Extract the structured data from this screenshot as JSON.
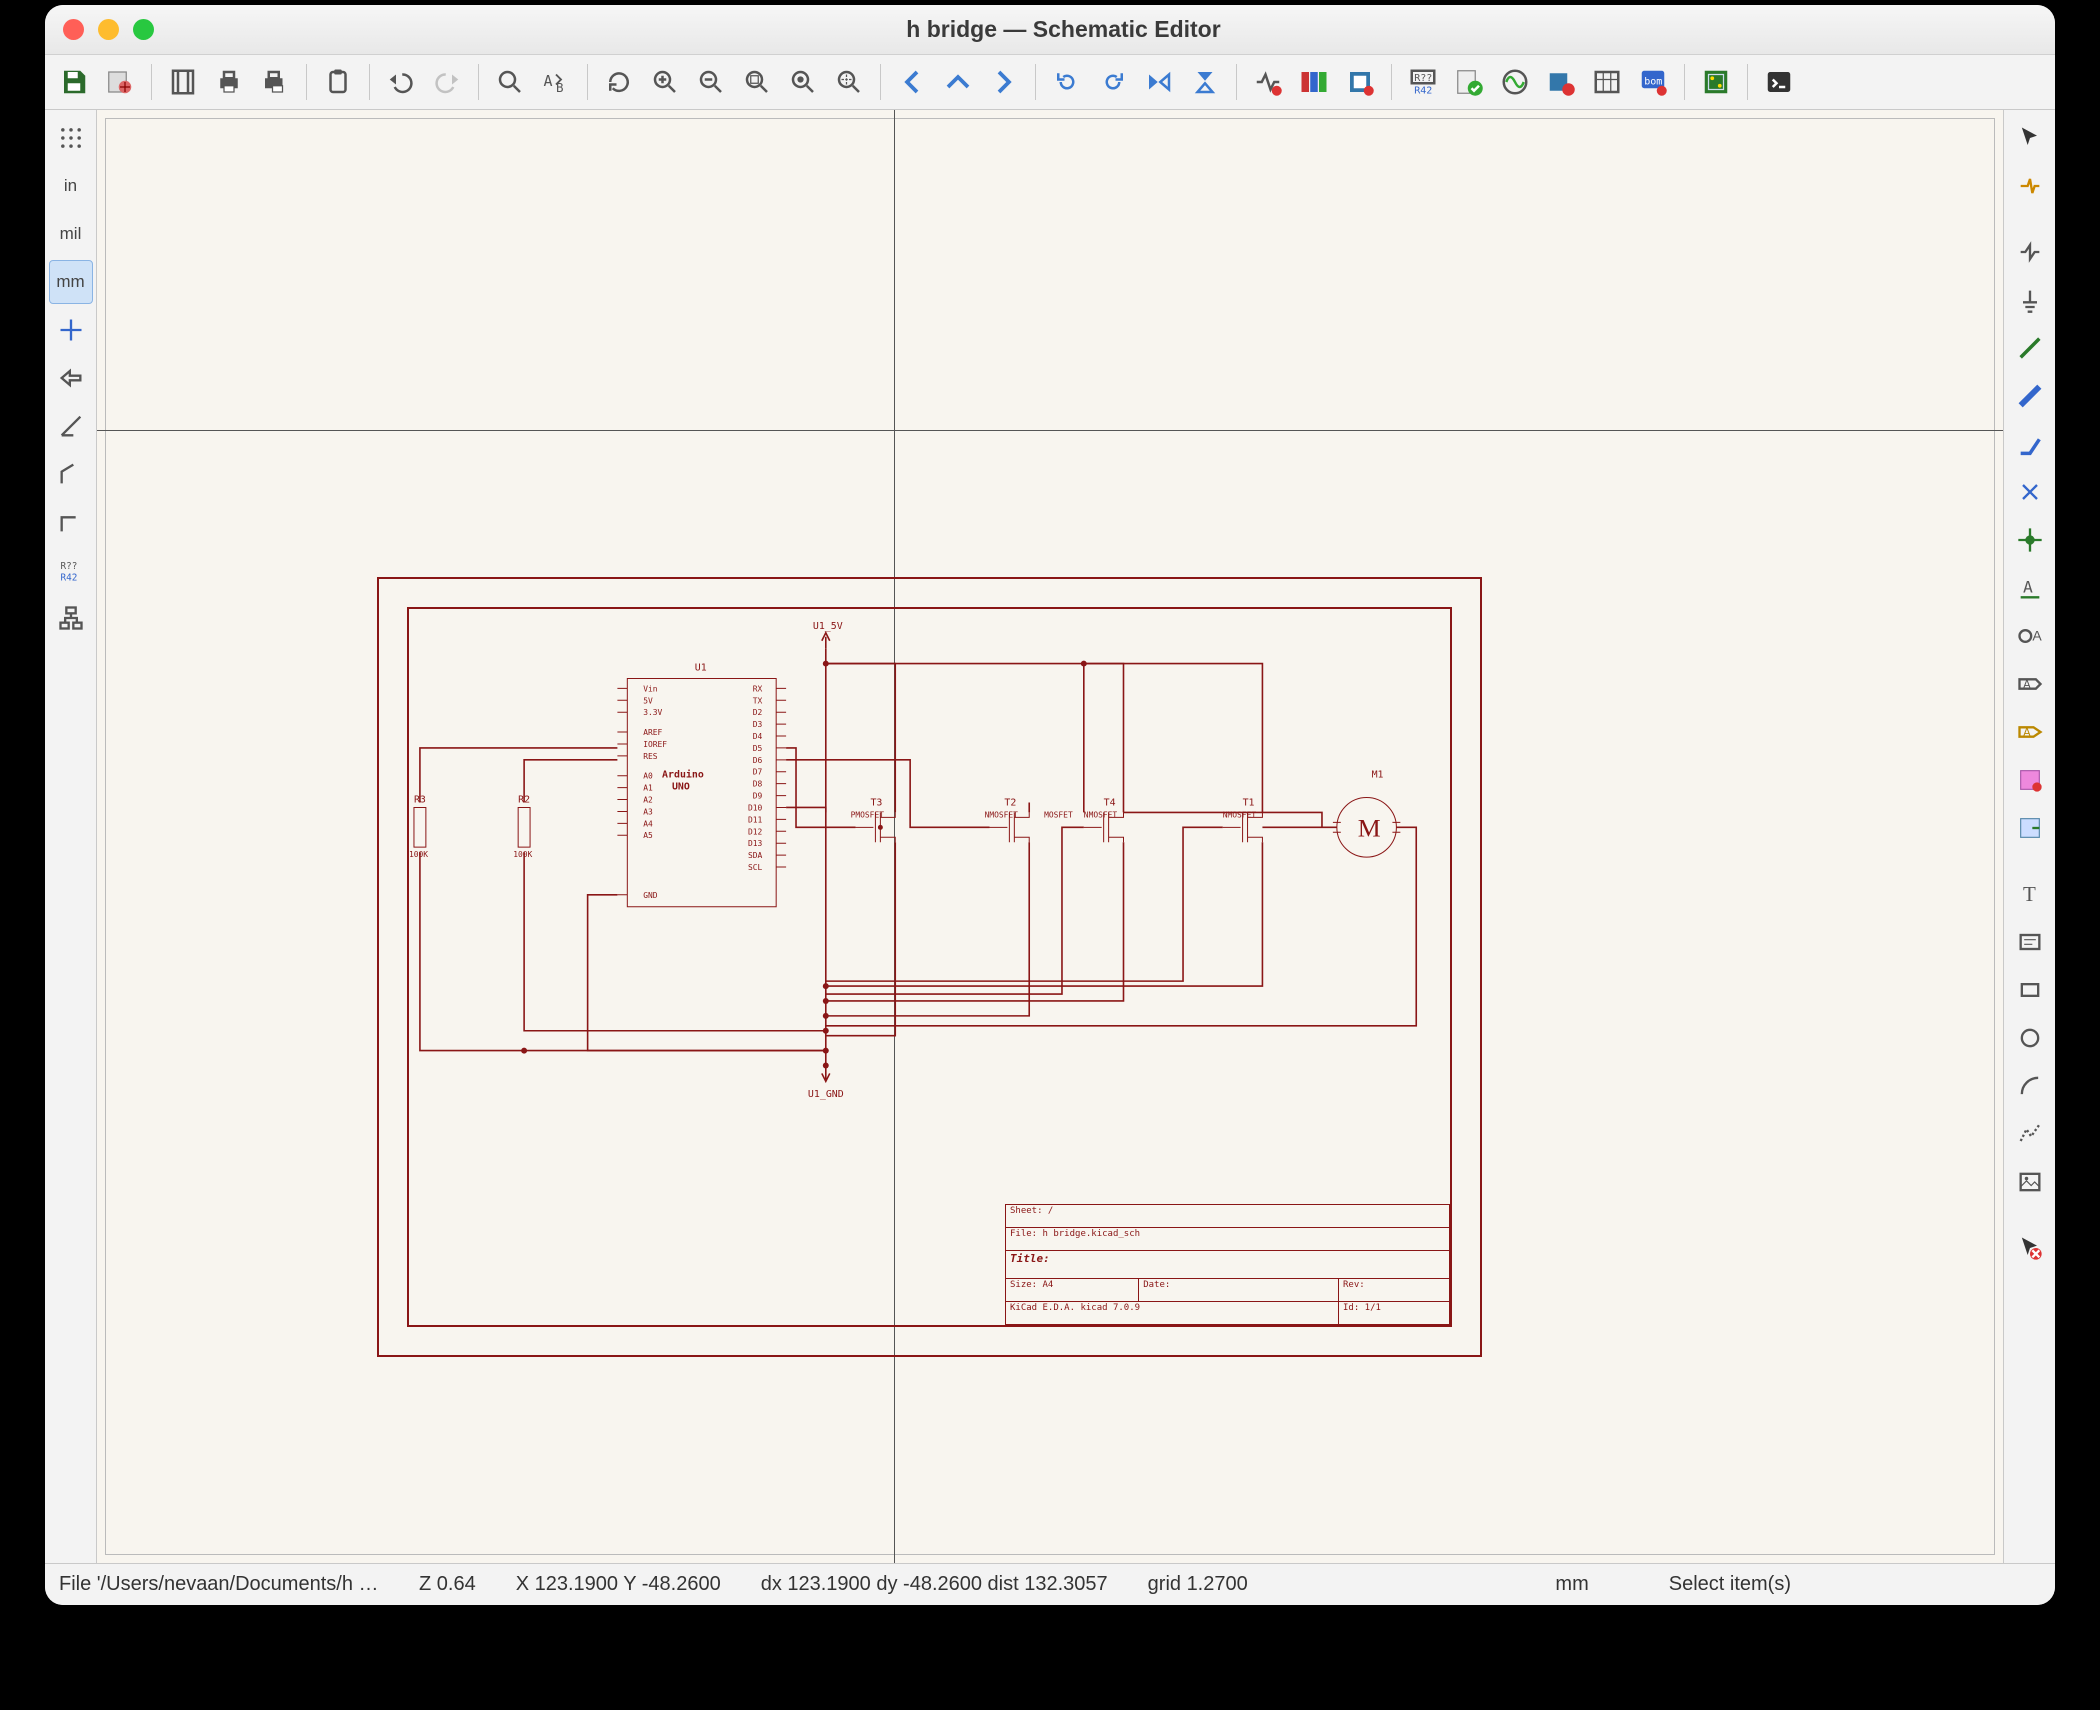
{
  "window": {
    "title": "h bridge — Schematic Editor"
  },
  "status": {
    "file": "File '/Users/nevaan/Documents/h bri…",
    "zoom": "Z 0.64",
    "xy": "X 123.1900  Y -48.2600",
    "dxy": "dx 123.1900  dy -48.2600  dist 132.3057",
    "grid": "grid 1.2700",
    "units": "mm",
    "mode": "Select item(s)"
  },
  "left_labels": {
    "in": "in",
    "mil": "mil",
    "mm": "mm"
  },
  "schematic": {
    "net_5v": "U1_5V",
    "net_gnd": "U1_GND",
    "u1_ref": "U1",
    "u1_name1": "Arduino",
    "u1_name2": "UNO",
    "pins_left": [
      "Vin",
      "5V",
      "3.3V",
      "",
      "AREF",
      "IOREF",
      "RES",
      "",
      "A0",
      "A1",
      "A2",
      "A3",
      "A4",
      "A5",
      "",
      "GND"
    ],
    "pins_right": [
      "RX",
      "TX",
      "D2",
      "D3",
      "D4",
      "D5",
      "D6",
      "D7",
      "D8",
      "D9",
      "D10",
      "D11",
      "D12",
      "D13",
      "SDA",
      "SCL"
    ],
    "r3_ref": "R3",
    "r3_val": "100K",
    "r2_ref": "R2",
    "r2_val": "100K",
    "t3_ref": "T3",
    "t3_val": "PMOSFET",
    "t2_ref": "T2",
    "t2_val": "NMOSFET",
    "t4_ref": "T4",
    "t4_val": "NMOSFET",
    "t1_ref": "T1",
    "t1_val": "NMOSFET",
    "m1_ref": "M1",
    "m1_sym": "M",
    "mid_lbl": "MOSFET"
  },
  "title_block": {
    "sheet": "Sheet: /",
    "file": "File: h bridge.kicad_sch",
    "title_lbl": "Title:",
    "size": "Size: A4",
    "date": "Date:",
    "rev": "Rev:",
    "eda": "KiCad E.D.A.  kicad 7.0.9",
    "id": "Id: 1/1"
  }
}
